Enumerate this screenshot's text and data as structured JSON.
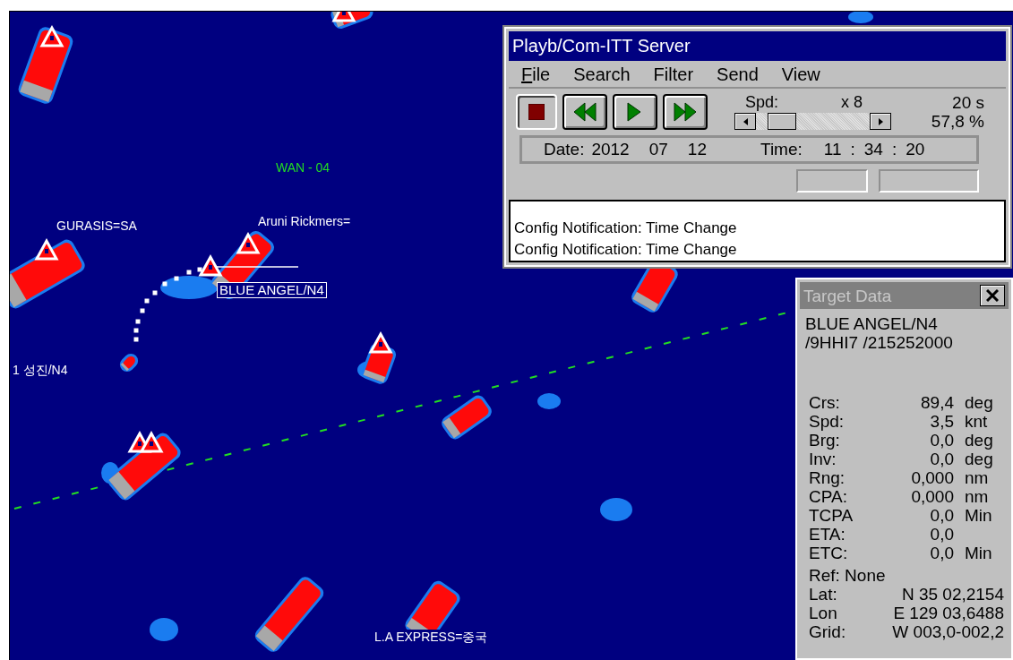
{
  "radar": {
    "labels": [
      {
        "text": "WAN - 04",
        "kind": "zone"
      },
      {
        "text": "GURASIS=SA",
        "kind": "vessel"
      },
      {
        "text": "Aruni Rickmers=",
        "kind": "vessel"
      },
      {
        "text": "BLUE ANGEL/N4",
        "kind": "selected"
      },
      {
        "text": "1 성진/N4",
        "kind": "vessel"
      },
      {
        "text": "L.A EXPRESS=중국",
        "kind": "vessel"
      }
    ]
  },
  "playback": {
    "title": "Playb/Com-ITT Server",
    "menu": [
      {
        "label": "File",
        "underlined": true
      },
      {
        "label": "Search",
        "underlined": false
      },
      {
        "label": "Filter",
        "underlined": false
      },
      {
        "label": "Send",
        "underlined": false
      },
      {
        "label": "View",
        "underlined": false
      }
    ],
    "buttons": [
      {
        "kind": "stop",
        "selected": true
      },
      {
        "kind": "rewind",
        "selected": false
      },
      {
        "kind": "play",
        "selected": false
      },
      {
        "kind": "fast-forward",
        "selected": false
      }
    ],
    "speed": {
      "label": "Spd:",
      "value": "x 8",
      "interval": "20 s",
      "percent": "57,8 %",
      "level": 0.1
    },
    "date": {
      "label": "Date:",
      "parts": [
        "2012",
        "07",
        "12"
      ]
    },
    "time": {
      "label": "Time:",
      "parts": [
        "11",
        ":",
        "34",
        ":",
        "20"
      ]
    },
    "log": [
      "Config Notification: Time Change",
      "Config Notification: Time Change"
    ]
  },
  "target": {
    "title": "Target Data",
    "active": false,
    "name": "BLUE ANGEL/N4",
    "ids": "/9HHI7 /215252000",
    "fields": [
      {
        "label": "Crs:",
        "value": "89,4",
        "unit": "deg"
      },
      {
        "label": "Spd:",
        "value": "3,5",
        "unit": "knt"
      },
      {
        "label": "Brg:",
        "value": "0,0",
        "unit": "deg"
      },
      {
        "label": "Inv:",
        "value": "0,0",
        "unit": "deg"
      },
      {
        "label": "Rng:",
        "value": "0,000",
        "unit": "nm"
      },
      {
        "label": "CPA:",
        "value": "0,000",
        "unit": "nm"
      },
      {
        "label": "TCPA",
        "value": "0,0",
        "unit": "Min"
      },
      {
        "label": "ETA:",
        "value": "0,0"
      },
      {
        "label": "ETC:",
        "value": "0,0",
        "unit": "Min"
      }
    ],
    "ref": "Ref: None",
    "position": [
      {
        "label": "Lat:",
        "value": "N 35 02,2154"
      },
      {
        "label": "Lon",
        "value": "E 129 03,6488"
      },
      {
        "label": "Grid:",
        "value": "W 003,0-002,2"
      }
    ]
  }
}
